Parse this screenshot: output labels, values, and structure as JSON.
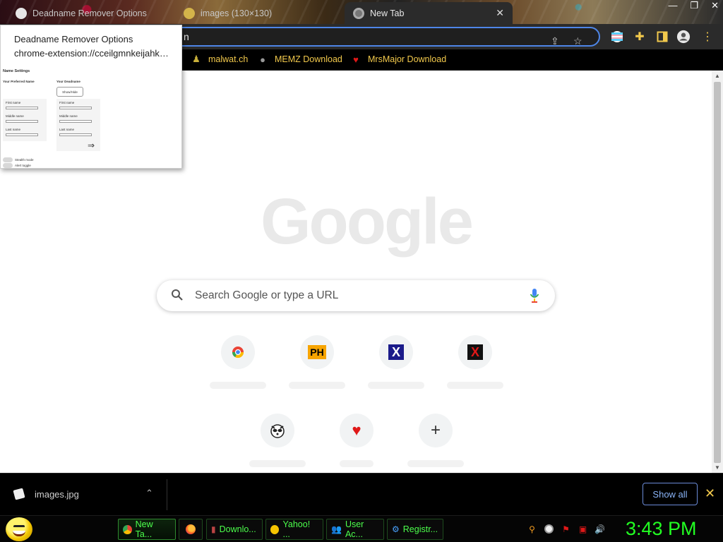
{
  "tabs": [
    {
      "title": "Deadname Remover Options",
      "active": false
    },
    {
      "title": "images (130×130)",
      "active": false
    },
    {
      "title": "New Tab",
      "active": true
    }
  ],
  "toolbar": {
    "omnibox_text": "n"
  },
  "bookmarks": [
    {
      "label": "malwat.ch",
      "icon": "person-icon"
    },
    {
      "label": "MEMZ Download",
      "icon": "globe-icon"
    },
    {
      "label": "MrsMajor Download",
      "icon": "heart-icon"
    }
  ],
  "popup": {
    "title": "Deadname Remover Options",
    "url": "chrome-extension://cceilgmnkeijahk…",
    "heading": "Name Settings",
    "preferred_heading": "Your Preferred Name",
    "deadname_heading": "Your Deadname",
    "deadname_button": "Show/Hide",
    "first_name": "First name",
    "middle_name": "Middle name",
    "last_name": "Last name",
    "arrow": "⇒",
    "toggle_1": "Stealth mode",
    "toggle_2": "Alert toggle"
  },
  "search": {
    "placeholder": "Search Google or type a URL"
  },
  "google_logo": "Google",
  "shortcuts": [
    {
      "icon": "chrome-icon"
    },
    {
      "icon": "ph-icon",
      "text": "PH"
    },
    {
      "icon": "x-blue-icon",
      "text": "X"
    },
    {
      "icon": "x-red-icon",
      "text": "X"
    },
    {
      "icon": "raccoon-icon"
    },
    {
      "icon": "heart-icon",
      "text": "♥"
    },
    {
      "icon": "add-shortcut-icon",
      "text": "+"
    }
  ],
  "download": {
    "filename": "images.jpg",
    "show_all": "Show all"
  },
  "taskbar": {
    "items": [
      {
        "label": "New Ta...",
        "icon": "chrome-icon",
        "active": true
      },
      {
        "label": "",
        "icon": "firefox-icon",
        "active": false
      },
      {
        "label": "Downlo...",
        "icon": "download-icon",
        "active": false
      },
      {
        "label": "Yahoo! ...",
        "icon": "yahoo-icon",
        "active": false
      },
      {
        "label": "User Ac...",
        "icon": "users-icon",
        "active": false
      },
      {
        "label": "Registr...",
        "icon": "registry-icon",
        "active": false
      }
    ],
    "clock": "3:43 PM"
  },
  "colors": {
    "bookmark_text": "#f2c94c",
    "taskbar_text": "#4cff4c",
    "clock": "#22ff22",
    "accent_blue": "#4e86e8"
  }
}
